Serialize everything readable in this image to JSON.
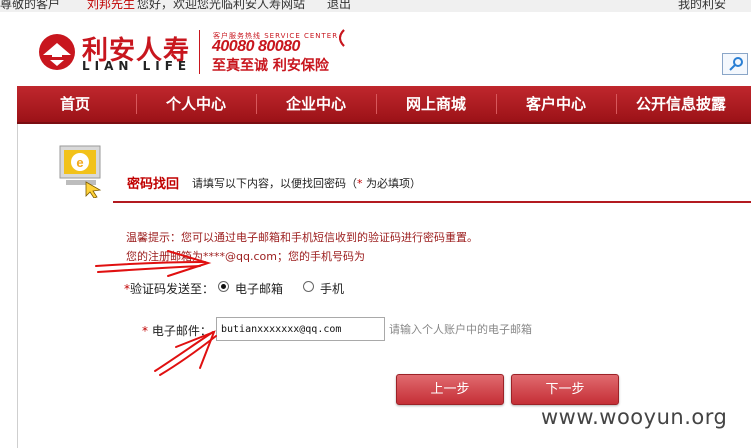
{
  "topbar": {
    "greeting_prefix": "尊敬的客户",
    "customer_name": "刘邦先生",
    "greeting_suffix": "您好，欢迎您光临利安人寿网站",
    "logout": "退出",
    "my_lian": "我的利安"
  },
  "header": {
    "brand_cn": "利安人寿",
    "brand_en": "LIAN LIFE",
    "service_small": "客户服务热线 SERVICE CENTER",
    "hotline": "40080 80080",
    "slogan": "至真至诚 利安保险"
  },
  "nav": {
    "items": [
      {
        "label": "首页"
      },
      {
        "label": "个人中心"
      },
      {
        "label": "企业中心"
      },
      {
        "label": "网上商城"
      },
      {
        "label": "客户中心"
      },
      {
        "label": "公开信息披露"
      }
    ]
  },
  "page": {
    "title": "密码找回",
    "subtitle_prefix": "请填写以下内容，以便找回密码（",
    "subtitle_star": "*",
    "subtitle_suffix": " 为必填项）",
    "tip_line1": "温馨提示：您可以通过电子邮箱和手机短信收到的验证码进行密码重置。",
    "tip_line2": "您的注册邮箱为****@qq.com；您的手机号码为"
  },
  "form": {
    "send_to_star": "*",
    "send_to_label": "验证码发送至：",
    "options": [
      {
        "label": "电子邮箱",
        "selected": true
      },
      {
        "label": "手机",
        "selected": false
      }
    ],
    "email_star": "*",
    "email_label": "电子邮件：",
    "email_value": "butianxxxxxxx@qq.com",
    "email_hint": "请输入个人账户中的电子邮箱",
    "prev_button": "上一步",
    "next_button": "下一步"
  },
  "watermark": "www.wooyun.org",
  "colors": {
    "brand_red": "#c8161e",
    "nav_red": "#a8161c",
    "tip_text": "#9b1c1c"
  }
}
